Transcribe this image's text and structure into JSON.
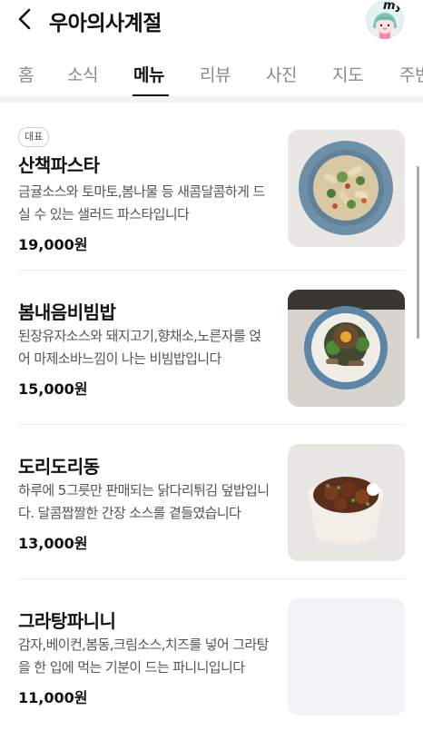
{
  "header": {
    "title": "우아의사계절",
    "my_label": "my"
  },
  "tabs": [
    {
      "label": "홈",
      "active": false
    },
    {
      "label": "소식",
      "active": false
    },
    {
      "label": "메뉴",
      "active": true
    },
    {
      "label": "리뷰",
      "active": false
    },
    {
      "label": "사진",
      "active": false
    },
    {
      "label": "지도",
      "active": false
    },
    {
      "label": "주변",
      "active": false
    }
  ],
  "menu": [
    {
      "badge": "대표",
      "name": "산책파스타",
      "description": "금귤소스와 토마토,봄나물 등 새콤달콤하게 드실 수 있는 샐러드 파스타입니다",
      "price": "19,000원"
    },
    {
      "name": "봄내음비빔밥",
      "description": "된장유자소스와 돼지고기,향채소,노른자를 얹어 마제소바느낌이 나는 비빔밥입니다",
      "price": "15,000원"
    },
    {
      "name": "도리도리동",
      "description": "하루에 5그릇만 판매되는 닭다리튀김 덮밥입니다. 달콤짭짤한 간장 소스를 곁들였습니다",
      "price": "13,000원"
    },
    {
      "name": "그라탕파니니",
      "description": "감자,베이컨,봄동,크림소스,치즈를 넣어 그라탕을 한 입에 먹는 기분이 드는 파니니입니다",
      "price": "11,000원"
    }
  ],
  "colors": {
    "active_tab": "#111111",
    "inactive_tab": "#8a8a8a",
    "divider": "#ececec",
    "plate_blue": "#6c8fa8"
  }
}
